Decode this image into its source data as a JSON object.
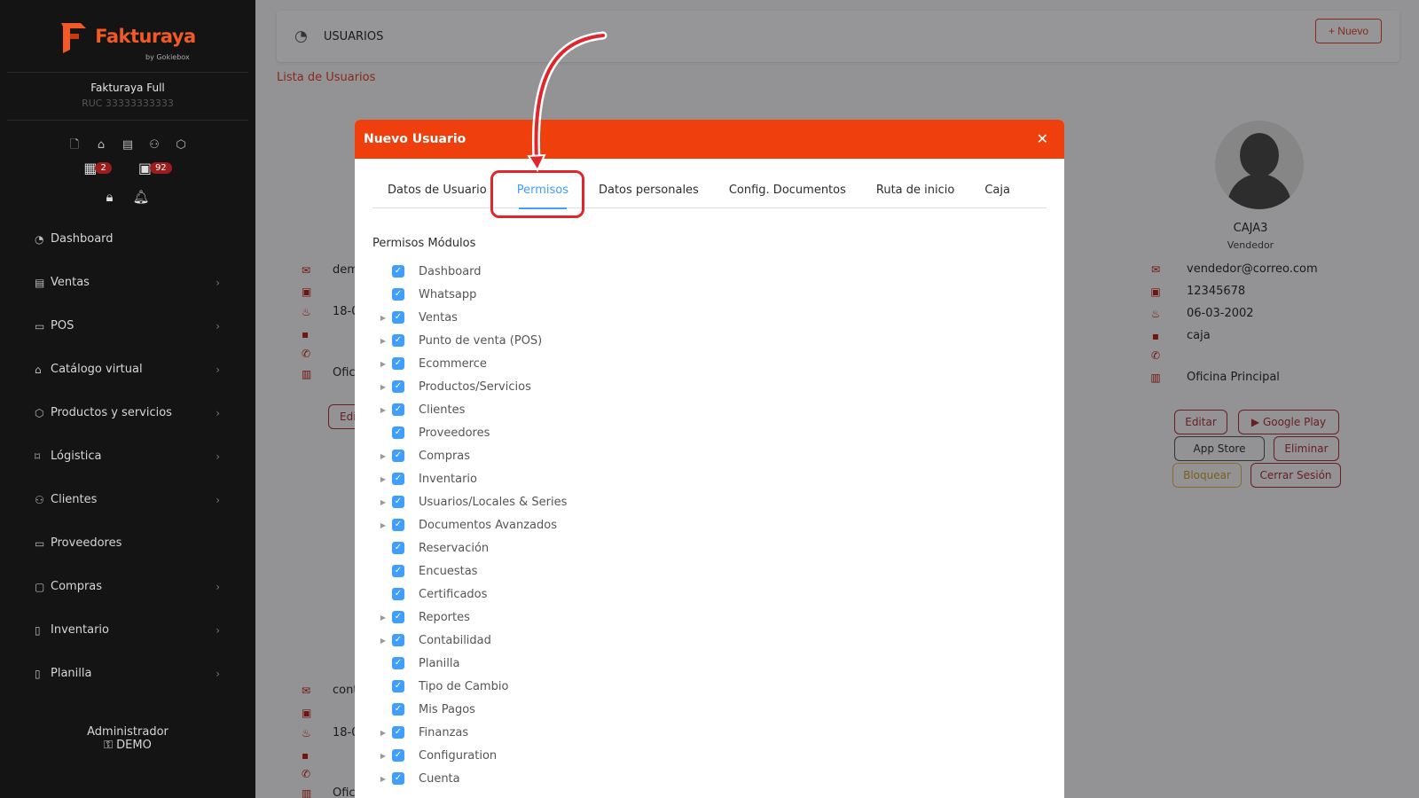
{
  "sidebar": {
    "brand": "Fakturaya",
    "brand_sub": "by Gokiebox",
    "company_name": "Fakturaya Full",
    "ruc": "RUC 33333333333",
    "badge_calendar": "2",
    "badge_box": "92",
    "items": [
      {
        "label": "Dashboard",
        "icon": "gauge-icon",
        "chevron": false
      },
      {
        "label": "Ventas",
        "icon": "receipt-icon",
        "chevron": true
      },
      {
        "label": "POS",
        "icon": "monitor-icon",
        "chevron": true
      },
      {
        "label": "Catálogo virtual",
        "icon": "store-icon",
        "chevron": true
      },
      {
        "label": "Productos y servicios",
        "icon": "box-icon",
        "chevron": true
      },
      {
        "label": "Lógistica",
        "icon": "tag-icon",
        "chevron": true
      },
      {
        "label": "Clientes",
        "icon": "users-icon",
        "chevron": true
      },
      {
        "label": "Proveedores",
        "icon": "briefcase-icon",
        "chevron": false
      },
      {
        "label": "Compras",
        "icon": "clipboard-icon",
        "chevron": true
      },
      {
        "label": "Inventario",
        "icon": "book-icon",
        "chevron": true
      },
      {
        "label": "Planilla",
        "icon": "id-icon",
        "chevron": true
      }
    ],
    "admin_role": "Administrador",
    "admin_user": "DEMO"
  },
  "header": {
    "title": "USUARIOS",
    "new_button": "+ Nuevo"
  },
  "breadcrumb": "Lista de Usuarios",
  "user_card_right": {
    "name": "CAJA3",
    "role": "Vendedor",
    "email": "vendedor@correo.com",
    "document": "12345678",
    "birthdate": "06-03-2002",
    "position": "caja",
    "phone": "",
    "office": "Oficina Principal",
    "btn_edit": "Editar",
    "btn_google": "Google Play",
    "btn_appstore": "App Store",
    "btn_delete": "Eliminar",
    "btn_block": "Bloquear",
    "btn_logout": "Cerrar Sesión"
  },
  "user_card_left_partial": {
    "email_start": "dem",
    "birth_start": "18-0",
    "office_start": "Ofic",
    "btn_edit_start": "Edi",
    "email2_start": "cont",
    "birth2_start": "18-0",
    "office2_start": "Ofic"
  },
  "modal": {
    "title": "Nuevo Usuario",
    "tabs": [
      "Datos de Usuario",
      "Permisos",
      "Datos personales",
      "Config. Documentos",
      "Ruta de inicio",
      "Caja"
    ],
    "active_tab": "Permisos",
    "permissions_title": "Permisos Módulos",
    "permissions": [
      {
        "label": "Dashboard",
        "expandable": false,
        "checked": true
      },
      {
        "label": "Whatsapp",
        "expandable": false,
        "checked": true
      },
      {
        "label": "Ventas",
        "expandable": true,
        "checked": true
      },
      {
        "label": "Punto de venta (POS)",
        "expandable": true,
        "checked": true
      },
      {
        "label": "Ecommerce",
        "expandable": true,
        "checked": true
      },
      {
        "label": "Productos/Servicios",
        "expandable": true,
        "checked": true
      },
      {
        "label": "Clientes",
        "expandable": true,
        "checked": true
      },
      {
        "label": "Proveedores",
        "expandable": false,
        "checked": true
      },
      {
        "label": "Compras",
        "expandable": true,
        "checked": true
      },
      {
        "label": "Inventario",
        "expandable": true,
        "checked": true
      },
      {
        "label": "Usuarios/Locales & Series",
        "expandable": true,
        "checked": true
      },
      {
        "label": "Documentos Avanzados",
        "expandable": true,
        "checked": true
      },
      {
        "label": "Reservación",
        "expandable": false,
        "checked": true
      },
      {
        "label": "Encuestas",
        "expandable": false,
        "checked": true
      },
      {
        "label": "Certificados",
        "expandable": false,
        "checked": true
      },
      {
        "label": "Reportes",
        "expandable": true,
        "checked": true
      },
      {
        "label": "Contabilidad",
        "expandable": true,
        "checked": true
      },
      {
        "label": "Planilla",
        "expandable": false,
        "checked": true
      },
      {
        "label": "Tipo de Cambio",
        "expandable": false,
        "checked": true
      },
      {
        "label": "Mis Pagos",
        "expandable": false,
        "checked": true
      },
      {
        "label": "Finanzas",
        "expandable": true,
        "checked": true
      },
      {
        "label": "Configuration",
        "expandable": true,
        "checked": true
      },
      {
        "label": "Cuenta",
        "expandable": true,
        "checked": true
      }
    ]
  },
  "colors": {
    "accent": "#ef3f0c",
    "tab_active": "#409eff",
    "sidebar_bg": "#141414",
    "annotation": "#e0262b"
  }
}
